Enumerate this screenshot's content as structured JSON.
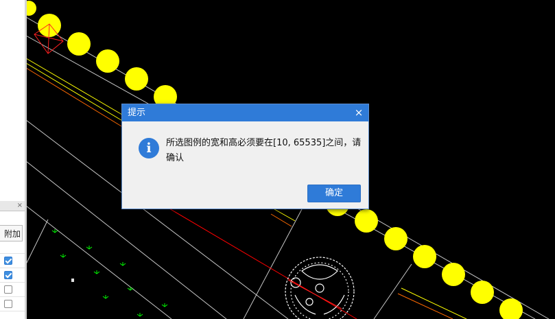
{
  "dialog": {
    "title": "提示",
    "close_symbol": "×",
    "icon": "info-icon",
    "message": "所选图例的宽和高必须要在[10, 65535]之间，请确认",
    "ok_label": "确定"
  },
  "left_panel": {
    "close_symbol": "×",
    "column_header": "附加",
    "rows": [
      {
        "checked": true
      },
      {
        "checked": true
      },
      {
        "checked": false
      },
      {
        "checked": false
      }
    ]
  },
  "colors": {
    "canvas_background": "#000000",
    "dialog_title_bar": "#2f7bd8",
    "symbol_fill": "#ffff00",
    "road_line": "#ff0000",
    "edge_line": "#ffff00",
    "tree_symbol": "#00ff00"
  }
}
